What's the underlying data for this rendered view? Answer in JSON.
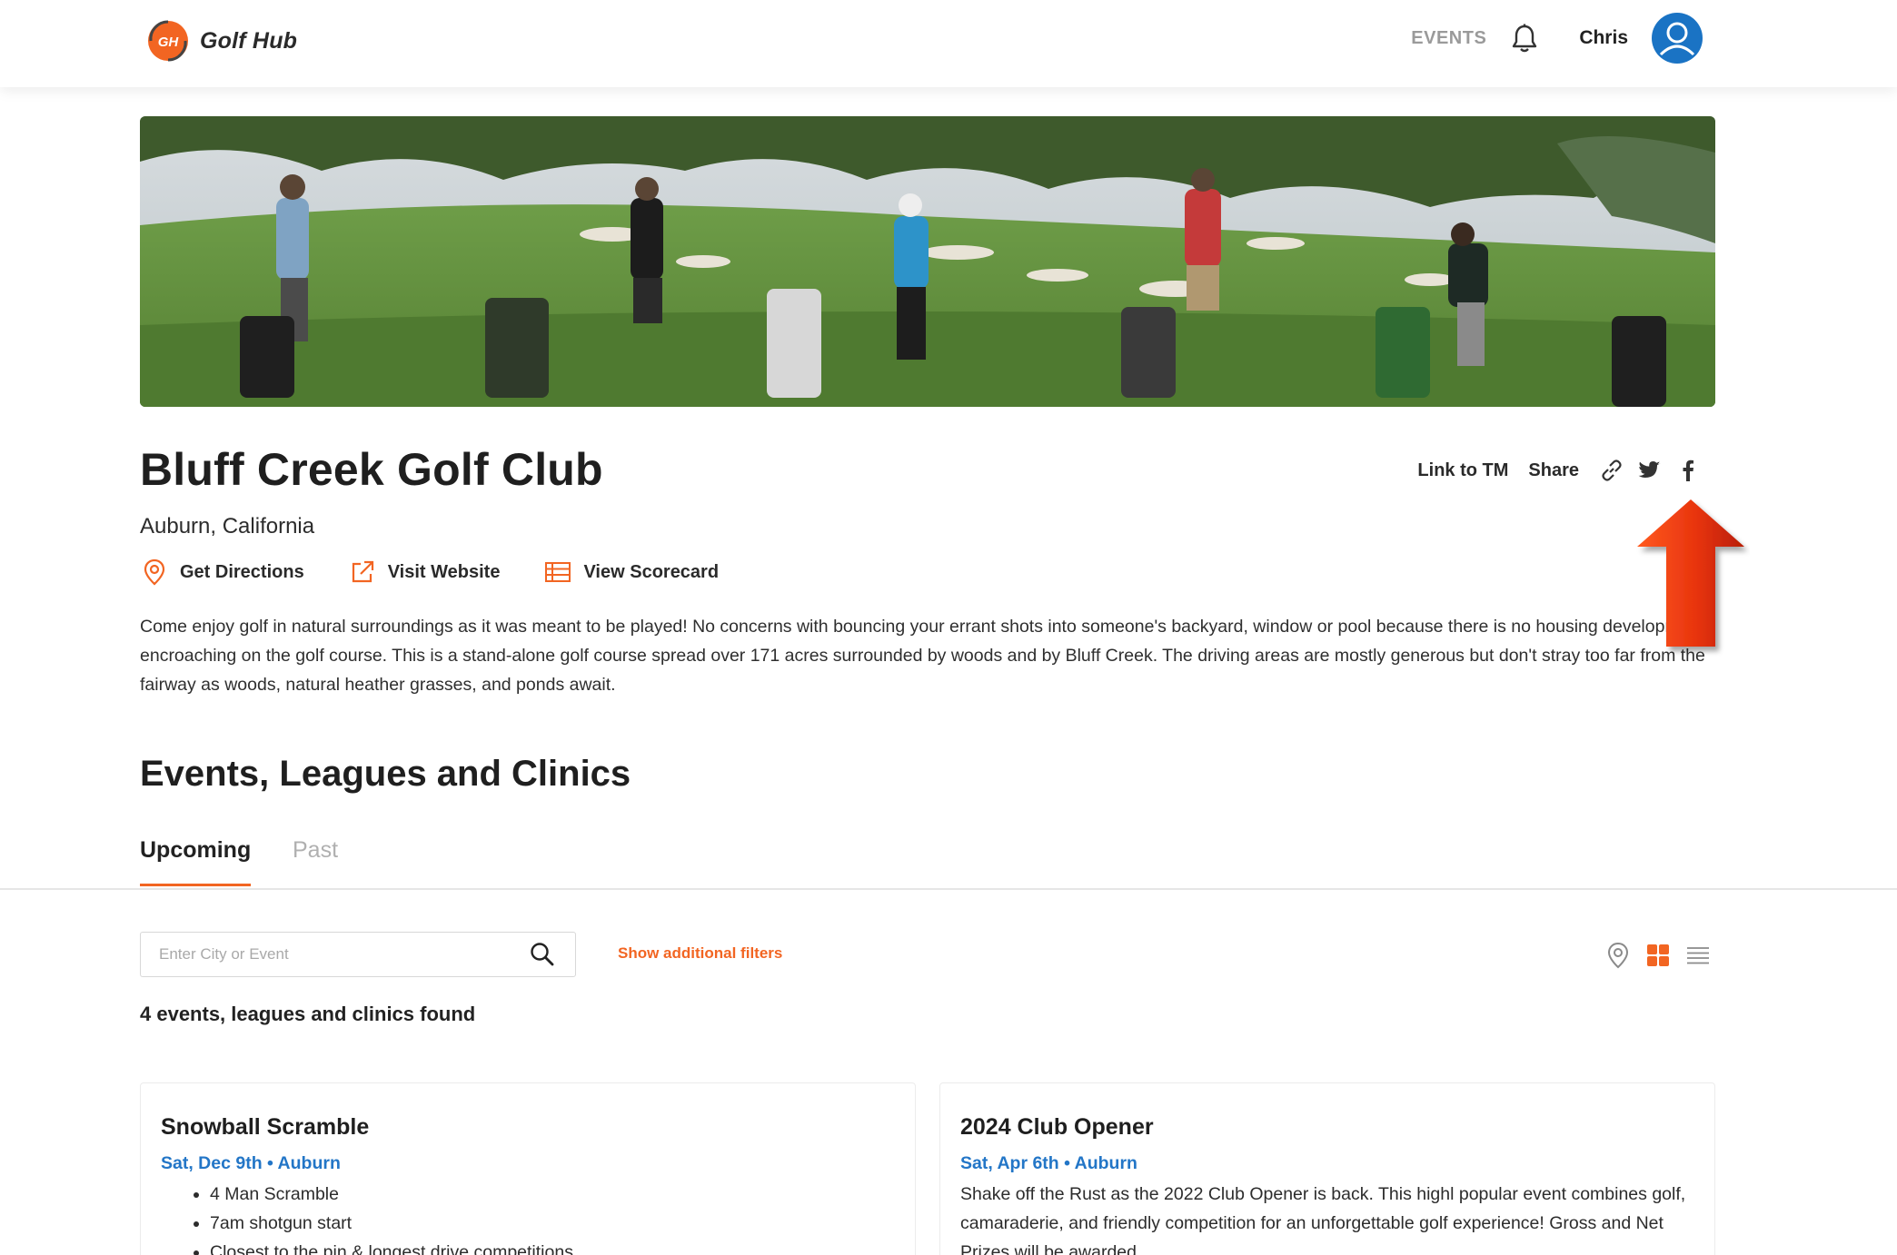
{
  "app": {
    "brand": "Golf Hub",
    "logo_initials": "GH"
  },
  "nav": {
    "events_label": "EVENTS",
    "user_name": "Chris"
  },
  "course": {
    "name": "Bluff Creek Golf Club",
    "location": "Auburn, California",
    "actions": {
      "directions": "Get Directions",
      "website": "Visit Website",
      "scorecard": "View Scorecard"
    },
    "description": "Come enjoy golf in natural surroundings as it was meant to be played! No concerns with bouncing your errant shots into someone's backyard, window or pool because there is no housing development encroaching on the golf course. This is a stand-alone golf course spread over 171 acres surrounded by woods and by Bluff Creek. The driving areas are mostly generous but don't stray too far from the fairway as woods, natural heather grasses, and ponds await."
  },
  "share": {
    "link_label": "Link to TM",
    "share_label": "Share",
    "icons": [
      "link-icon",
      "twitter-icon",
      "facebook-icon"
    ]
  },
  "events": {
    "title": "Events, Leagues and Clinics",
    "tabs": {
      "upcoming": "Upcoming",
      "past": "Past"
    },
    "search": {
      "placeholder": "Enter City or Event",
      "value": ""
    },
    "filters_label": "Show additional filters",
    "count_text": "4 events, leagues and clinics found",
    "cards": [
      {
        "title": "Snowball Scramble",
        "meta": "Sat, Dec 9th • Auburn",
        "bullets": [
          "4 Man Scramble",
          "7am shotgun start",
          "Closest to the pin & longest drive competitions"
        ]
      },
      {
        "title": "2024 Club Opener",
        "meta": "Sat, Apr 6th • Auburn",
        "text": "Shake off the Rust as the 2022 Club Opener is back. This highl popular event combines golf, camaraderie, and friendly competition for an unforgettable golf experience! Gross and Net Prizes will be awarded."
      }
    ]
  },
  "colors": {
    "accent": "#f26522",
    "link_blue": "#2376c7",
    "avatar_blue": "#1a73c4",
    "arrow_red": "#e8340e"
  }
}
